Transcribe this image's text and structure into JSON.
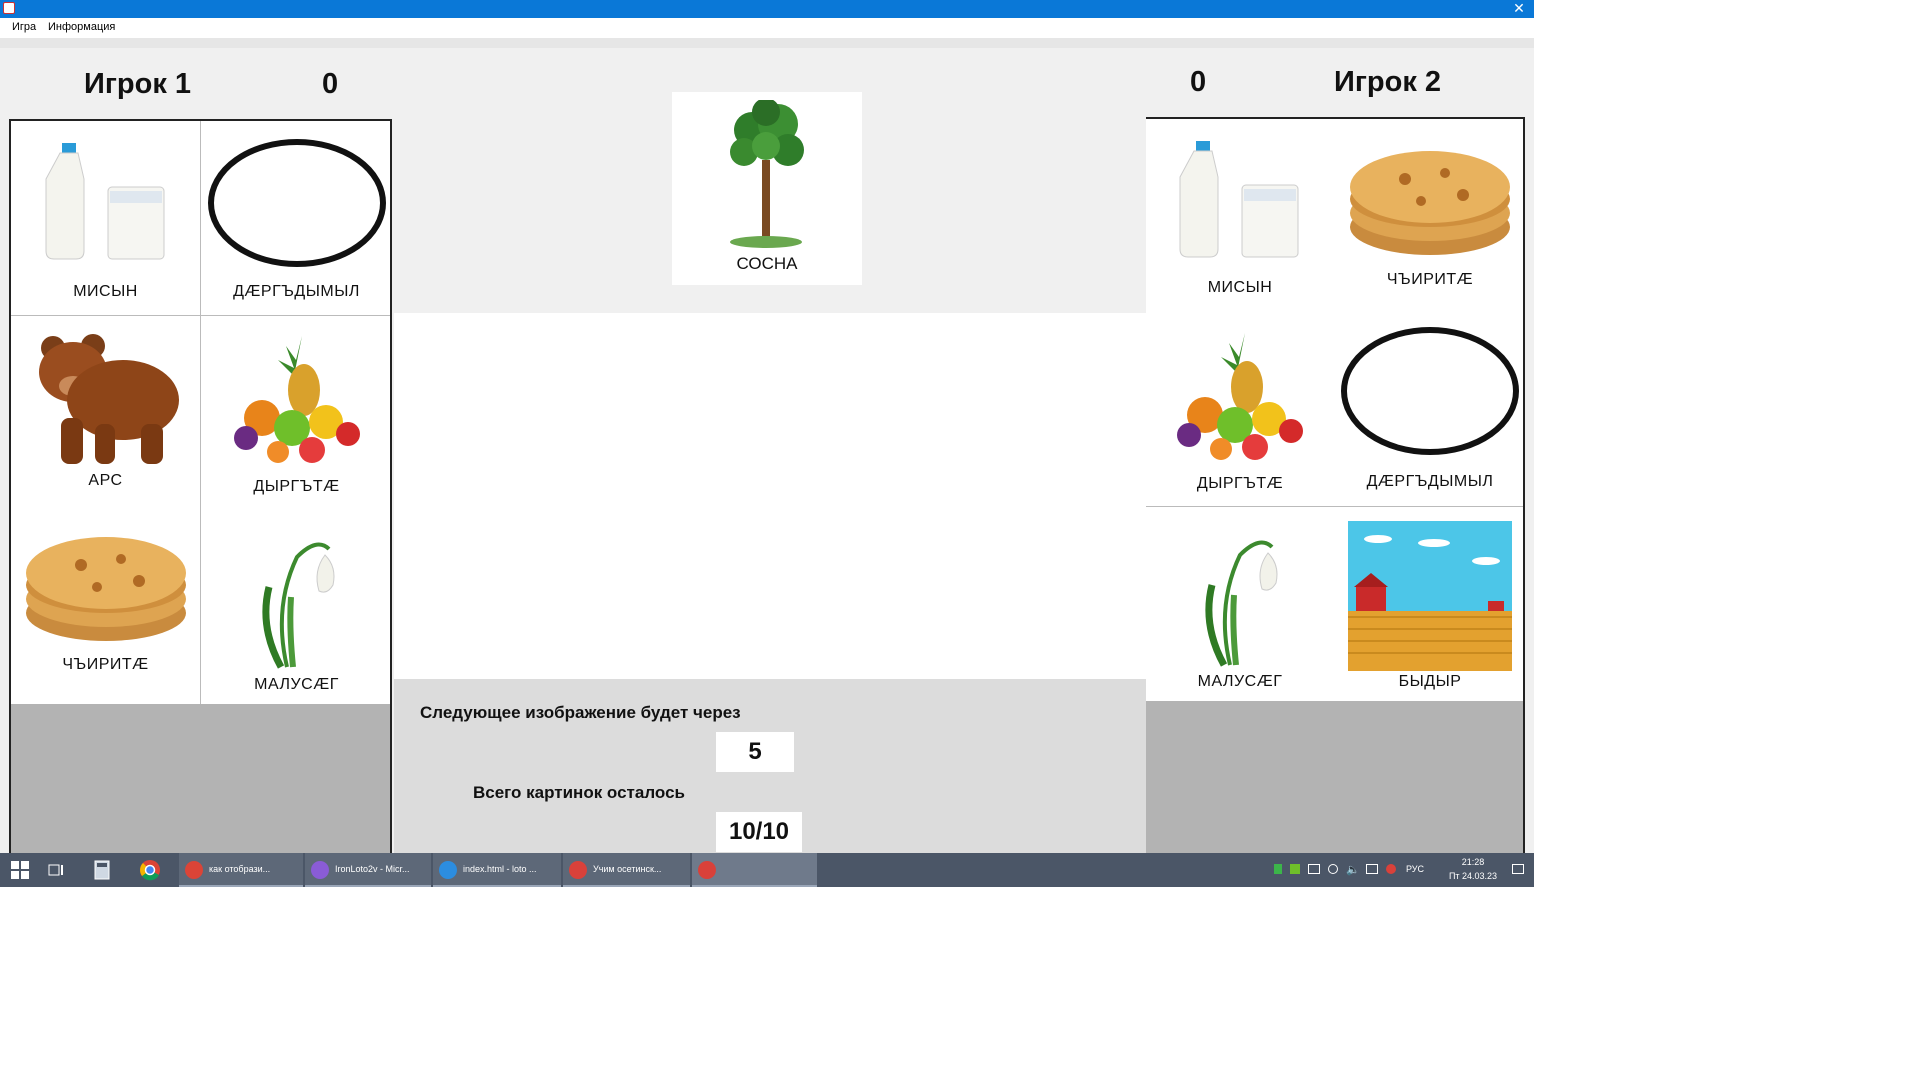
{
  "window": {
    "close_glyph": "✕"
  },
  "menu": {
    "items": [
      "Игра",
      "Информация"
    ]
  },
  "player1": {
    "name": "Игрок 1",
    "score": "0",
    "cards": [
      {
        "label": "МИСЫН",
        "icon": "milk-icon"
      },
      {
        "label": "ДÆРГЪДЫМЫЛ",
        "icon": "circle-icon"
      },
      {
        "label": "АРС",
        "icon": "bear-icon"
      },
      {
        "label": "ДЫРГЪТÆ",
        "icon": "fruits-icon"
      },
      {
        "label": "ЧЪИРИТÆ",
        "icon": "pie-icon"
      },
      {
        "label": "МАЛУСÆГ",
        "icon": "snowdrop-icon"
      }
    ]
  },
  "player2": {
    "name": "Игрок 2",
    "score": "0",
    "cards": [
      {
        "label": "МИСЫН",
        "icon": "milk-icon"
      },
      {
        "label": "ЧЪИРИТÆ",
        "icon": "pie-icon"
      },
      {
        "label": "ДЫРГЪТÆ",
        "icon": "fruits-icon"
      },
      {
        "label": "ДÆРГЪДЫМЫЛ",
        "icon": "circle-icon"
      },
      {
        "label": "МАЛУСÆГ",
        "icon": "snowdrop-icon"
      },
      {
        "label": "БЫДЫР",
        "icon": "field-icon"
      }
    ]
  },
  "current": {
    "label": "СОСНА",
    "icon": "pine-tree-icon"
  },
  "info": {
    "next_label": "Следующее изображение будет через",
    "next_value": "5",
    "remaining_label": "Всего картинок осталось",
    "remaining_value": "10/10"
  },
  "taskbar": {
    "apps": [
      {
        "label": "как отобрази...",
        "color": "#db4437"
      },
      {
        "label": "IronLoto2v - Micr...",
        "color": "#8a5cd6"
      },
      {
        "label": "index.html - loto ...",
        "color": "#2c8de0"
      },
      {
        "label": "Учим осетинск...",
        "color": "#d9413a"
      },
      {
        "label": "",
        "color": "#d9413a"
      }
    ],
    "lang": "РУС",
    "time": "21:28",
    "date": "Пт 24.03.23"
  }
}
